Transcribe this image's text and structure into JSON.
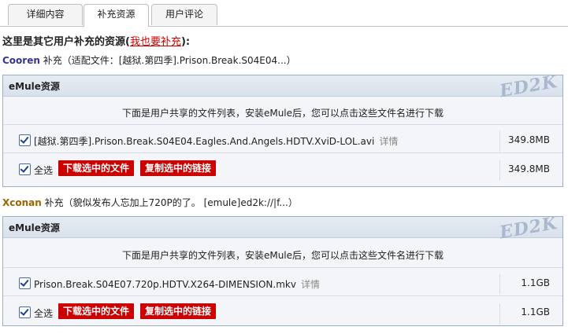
{
  "tabs": [
    {
      "label": "详细内容"
    },
    {
      "label": "补充资源"
    },
    {
      "label": "用户评论"
    }
  ],
  "intro": {
    "text": "这里是其它用户补充的资源(",
    "link": "我也要补充",
    "end": "):"
  },
  "entries": [
    {
      "user": "Cooren",
      "supplement": " 补充（适配文件：[越狱.第四季].Prison.Break.S04E04...）",
      "box_title": "eMule资源",
      "badge": "ED2K",
      "notice": "下面是用户共享的文件列表，安装eMule后，您可以点击这些文件名进行下载",
      "file": {
        "name": "[越狱.第四季].Prison.Break.S04E04.Eagles.And.Angels.HDTV.XviD-LOL.avi",
        "detail": "详情",
        "size": "349.8MB"
      },
      "select_all": "全选",
      "download_btn": "下载选中的文件",
      "copy_btn": "复制选中的链接",
      "total": "349.8MB"
    },
    {
      "user": "Xconan",
      "supplement": " 补充（貌似发布人忘加上720P的了。 [emule]ed2k://|f...）",
      "box_title": "eMule资源",
      "badge": "ED2K",
      "notice": "下面是用户共享的文件列表，安装eMule后，您可以点击这些文件名进行下载",
      "file": {
        "name": "Prison.Break.S04E07.720p.HDTV.X264-DIMENSION.mkv",
        "detail": "详情",
        "size": "1.1GB"
      },
      "select_all": "全选",
      "download_btn": "下载选中的文件",
      "copy_btn": "复制选中的链接",
      "total": "1.1GB"
    }
  ]
}
